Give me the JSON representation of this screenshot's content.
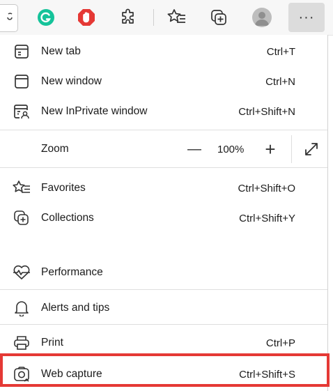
{
  "toolbar": {
    "icons": [
      "grammarly-icon",
      "adblock-icon",
      "extensions-icon",
      "favorites-icon",
      "collections-icon",
      "profile-icon",
      "more-icon"
    ],
    "more_label": "···"
  },
  "menu": {
    "new_tab": {
      "label": "New tab",
      "shortcut": "Ctrl+T"
    },
    "new_window": {
      "label": "New window",
      "shortcut": "Ctrl+N"
    },
    "new_inprivate": {
      "label": "New InPrivate window",
      "shortcut": "Ctrl+Shift+N"
    },
    "zoom": {
      "label": "Zoom",
      "minus": "—",
      "value": "100%",
      "plus": "+"
    },
    "favorites": {
      "label": "Favorites",
      "shortcut": "Ctrl+Shift+O"
    },
    "collections": {
      "label": "Collections",
      "shortcut": "Ctrl+Shift+Y"
    },
    "performance": {
      "label": "Performance",
      "shortcut": ""
    },
    "alerts": {
      "label": "Alerts and tips",
      "shortcut": ""
    },
    "print": {
      "label": "Print",
      "shortcut": "Ctrl+P"
    },
    "web_capture": {
      "label": "Web capture",
      "shortcut": "Ctrl+Shift+S"
    }
  },
  "colors": {
    "highlight_border": "#e53935",
    "grammarly_green": "#15c39a",
    "adblock_red": "#e53935"
  }
}
